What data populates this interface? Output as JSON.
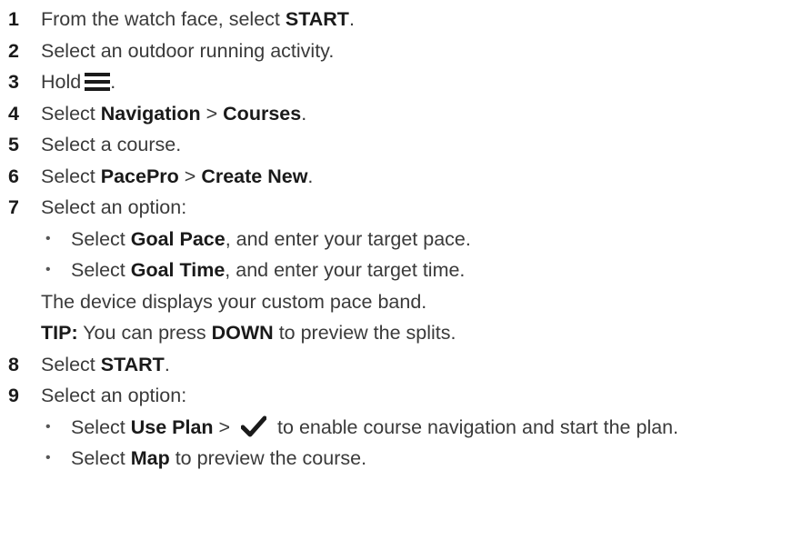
{
  "steps": [
    {
      "num": "1",
      "pre": "From the watch face, select ",
      "b1": "START",
      "post": "."
    },
    {
      "num": "2",
      "text": "Select an outdoor running activity."
    },
    {
      "num": "3",
      "pre": "Hold",
      "icon": "menu-icon",
      "post": "."
    },
    {
      "num": "4",
      "pre": "Select ",
      "b1": "Navigation",
      "mid": " > ",
      "b2": "Courses",
      "post": "."
    },
    {
      "num": "5",
      "text": "Select a course."
    },
    {
      "num": "6",
      "pre": "Select ",
      "b1": "PacePro",
      "mid": " > ",
      "b2": "Create New",
      "post": "."
    },
    {
      "num": "7",
      "text": "Select an option:",
      "bullets": [
        {
          "pre": "Select ",
          "b": "Goal Pace",
          "post": ", and enter your target pace."
        },
        {
          "pre": "Select ",
          "b": "Goal Time",
          "post": ", and enter your target time."
        }
      ],
      "note": "The device displays your custom pace band.",
      "tip": {
        "label": "TIP:",
        "pre": " You can press ",
        "b": "DOWN",
        "post": " to preview the splits."
      }
    },
    {
      "num": "8",
      "pre": "Select ",
      "b1": "START",
      "post": "."
    },
    {
      "num": "9",
      "text": "Select an option:",
      "bullets": [
        {
          "pre": "Select ",
          "b": "Use Plan",
          "mid": " > ",
          "icon": "check-icon",
          "post": " to enable course navigation and start the plan."
        },
        {
          "pre": "Select ",
          "b": "Map",
          "post": " to preview the course."
        }
      ]
    }
  ],
  "bullet_char": "•"
}
